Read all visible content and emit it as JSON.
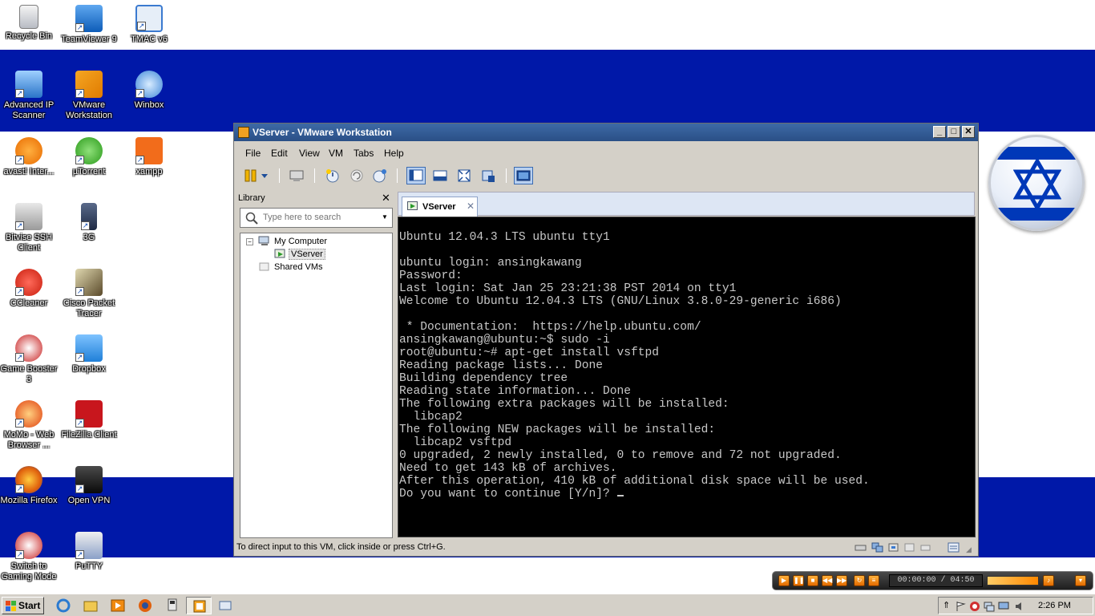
{
  "desktop": {
    "icons": [
      {
        "label": "Recycle Bin",
        "icon": "recycle-bin-icon"
      },
      {
        "label": "TeamViewer 9",
        "icon": "teamviewer-icon"
      },
      {
        "label": "TMAC v6",
        "icon": "tmac-icon"
      },
      {
        "label": "Advanced IP Scanner",
        "icon": "ip-scanner-icon"
      },
      {
        "label": "VMware Workstation",
        "icon": "vmware-icon"
      },
      {
        "label": "Winbox",
        "icon": "winbox-icon"
      },
      {
        "label": "avast! Inter...",
        "icon": "avast-icon"
      },
      {
        "label": "µTorrent",
        "icon": "utorrent-icon"
      },
      {
        "label": "xampp",
        "icon": "xampp-icon"
      },
      {
        "label": "Bitvise SSH Client",
        "icon": "bitvise-icon"
      },
      {
        "label": "3G",
        "icon": "modem-icon"
      },
      {
        "label": "CCleaner",
        "icon": "ccleaner-icon"
      },
      {
        "label": "Cisco Packet Tracer",
        "icon": "packet-tracer-icon"
      },
      {
        "label": "Game Booster 3",
        "icon": "game-booster-icon"
      },
      {
        "label": "Dropbox",
        "icon": "dropbox-icon"
      },
      {
        "label": "MoMo - Web Browser ...",
        "icon": "momo-icon"
      },
      {
        "label": "FileZilla Client",
        "icon": "filezilla-icon"
      },
      {
        "label": "Mozilla Firefox",
        "icon": "firefox-icon"
      },
      {
        "label": "Open VPN",
        "icon": "openvpn-icon"
      },
      {
        "label": "Switch to Gaming Mode",
        "icon": "gaming-mode-icon"
      },
      {
        "label": "PuTTY",
        "icon": "putty-icon"
      }
    ]
  },
  "window": {
    "title": "VServer - VMware Workstation",
    "menu": [
      "File",
      "Edit",
      "View",
      "VM",
      "Tabs",
      "Help"
    ],
    "library": {
      "header": "Library",
      "search_placeholder": "Type here to search",
      "tree": {
        "root": "My Computer",
        "vm": "VServer",
        "shared": "Shared VMs"
      }
    },
    "tab_label": "VServer",
    "console_lines": [
      "Ubuntu 12.04.3 LTS ubuntu tty1",
      "",
      "ubuntu login: ansingkawang",
      "Password:",
      "Last login: Sat Jan 25 23:21:38 PST 2014 on tty1",
      "Welcome to Ubuntu 12.04.3 LTS (GNU/Linux 3.8.0-29-generic i686)",
      "",
      " * Documentation:  https://help.ubuntu.com/",
      "ansingkawang@ubuntu:~$ sudo -i",
      "root@ubuntu:~# apt-get install vsftpd",
      "Reading package lists... Done",
      "Building dependency tree",
      "Reading state information... Done",
      "The following extra packages will be installed:",
      "  libcap2",
      "The following NEW packages will be installed:",
      "  libcap2 vsftpd",
      "0 upgraded, 2 newly installed, 0 to remove and 72 not upgraded.",
      "Need to get 143 kB of archives.",
      "After this operation, 410 kB of additional disk space will be used.",
      "Do you want to continue [Y/n]? "
    ],
    "status_text": "To direct input to this VM, click inside or press Ctrl+G."
  },
  "media_player": {
    "time": "00:00:00 / 04:50"
  },
  "taskbar": {
    "start_label": "Start",
    "clock": "2:26 PM"
  },
  "colors": {
    "flag_blue": "#0018a8",
    "title_blue": "#2a4f86",
    "console_bg": "#000000"
  }
}
